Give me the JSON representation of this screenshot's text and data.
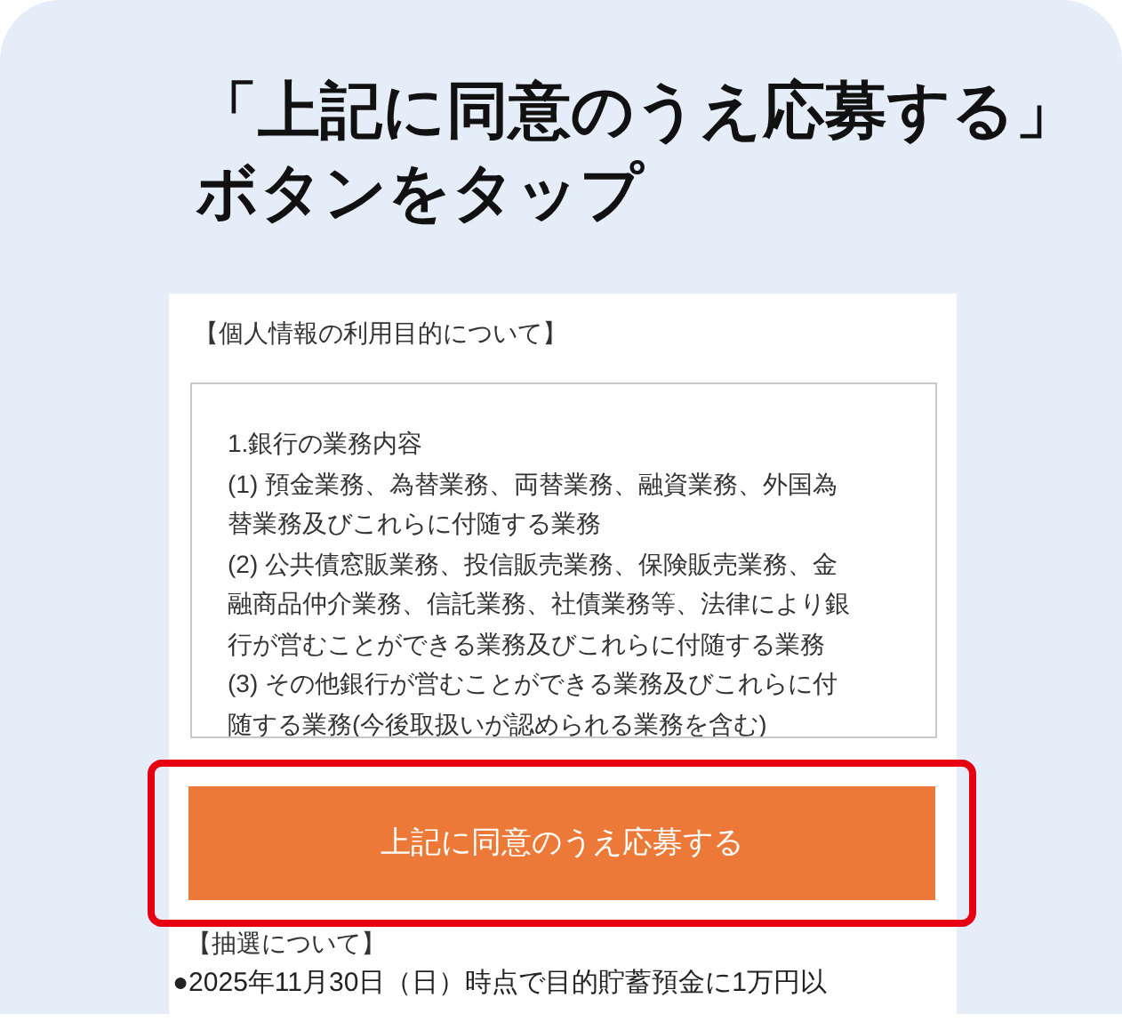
{
  "heading": {
    "lines": [
      "「上記に同意のうえ応募する」",
      "ボタンをタップ"
    ]
  },
  "card": {
    "section_title": "【個人情報の利用目的について】",
    "scroll_box": {
      "lines": [
        "1.銀行の業務内容",
        "(1) 預金業務、為替業務、両替業務、融資業務、外国為",
        "替業務及びこれらに付随する業務",
        "(2) 公共債窓販業務、投信販売業務、保険販売業務、金",
        "融商品仲介業務、信託業務、社債業務等、法律により銀",
        "行が営むことができる業務及びこれらに付随する業務",
        "(3) その他銀行が営むことができる業務及びこれらに付",
        "随する業務(今後取扱いが認められる業務を含む)"
      ]
    },
    "button": {
      "label": "上記に同意のうえ応募する",
      "highlighted": true
    },
    "lottery_title": "【抽選について】",
    "lottery_text": "●2025年11月30日（日）時点で目的貯蓄預金に1万円以"
  }
}
